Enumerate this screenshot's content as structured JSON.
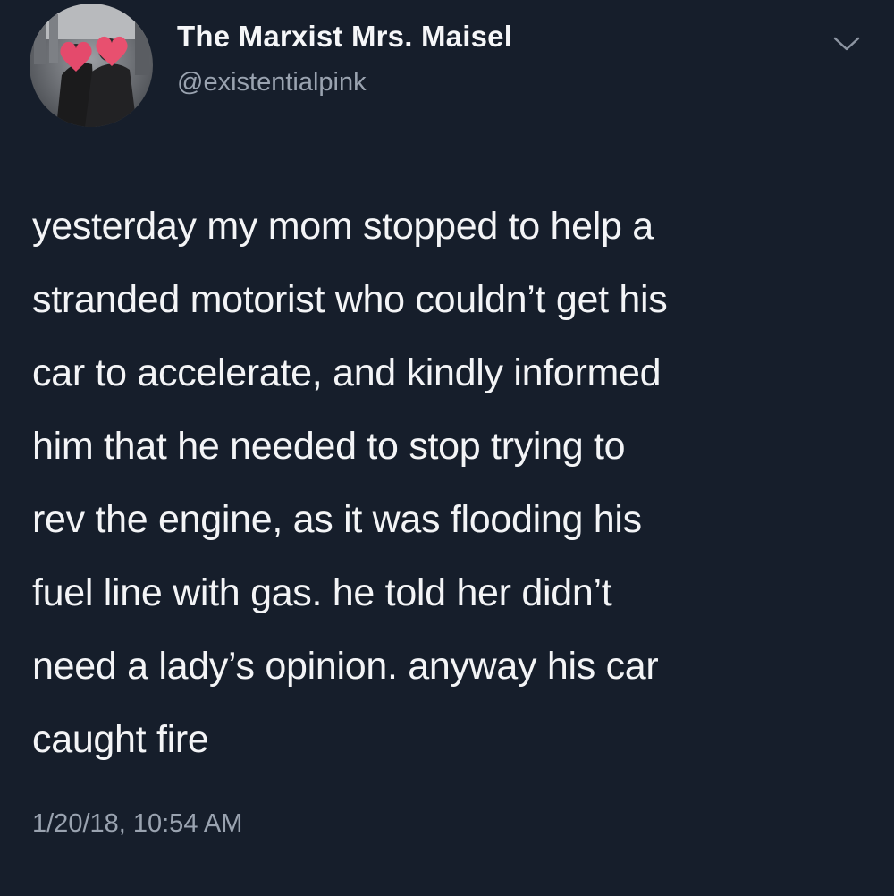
{
  "author": {
    "name": "The Marxist Mrs. Maisel",
    "handle": "@existentialpink"
  },
  "tweet": {
    "lines": [
      "yesterday my mom stopped to help a",
      "stranded motorist who couldn’t get his",
      "car to accelerate, and kindly informed",
      "him that he needed to stop trying to",
      "rev the engine, as it was flooding his",
      "fuel line with gas. he told her didn’t",
      "need a lady’s opinion. anyway his car",
      "caught fire"
    ],
    "timestamp": "1/20/18, 10:54 AM"
  },
  "icons": {
    "menu": "chevron-down-icon"
  },
  "colors": {
    "background": "#161e2b",
    "text": "#f3f4f6",
    "secondary_text": "#9aa3b0"
  }
}
